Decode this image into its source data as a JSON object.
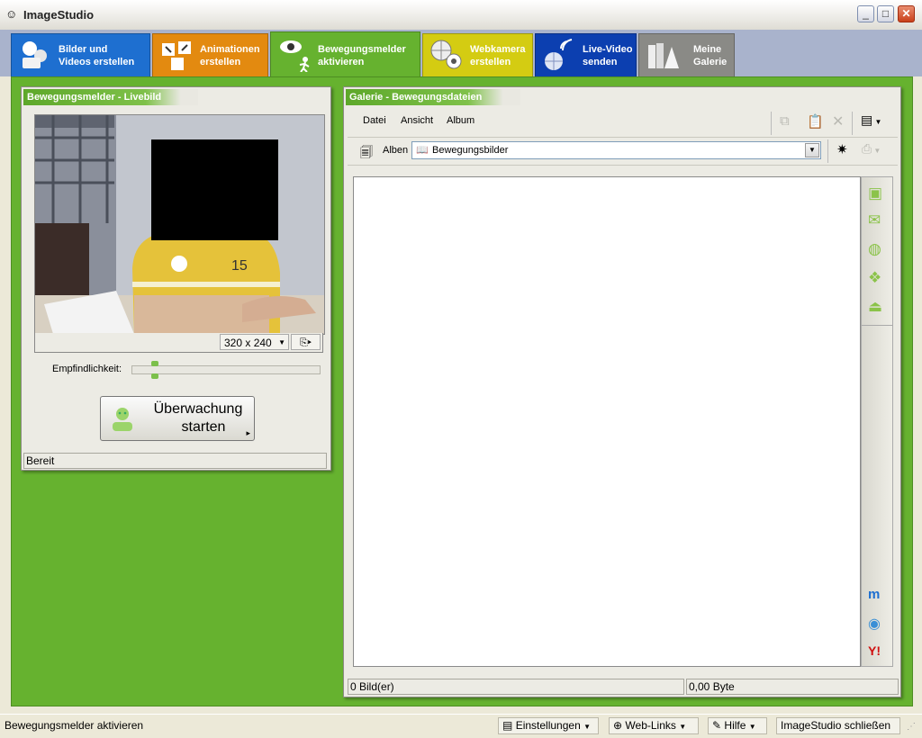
{
  "app": {
    "title": "ImageStudio"
  },
  "tabs": [
    {
      "line1": "Bilder und",
      "line2": "Videos erstellen",
      "color": "#1e6fd0"
    },
    {
      "line1": "Animationen",
      "line2": "erstellen",
      "color": "#e38a10"
    },
    {
      "line1": "Bewegungsmelder",
      "line2": "aktivieren",
      "color": "#66b22f",
      "active": true
    },
    {
      "line1": "Webkamera",
      "line2": "erstellen",
      "color": "#d4cc12"
    },
    {
      "line1": "Live-Video",
      "line2": "senden",
      "color": "#0c3fb0"
    },
    {
      "line1": "Meine",
      "line2": "Galerie",
      "color": "#8a8a86"
    }
  ],
  "left_panel": {
    "title": "Bewegungsmelder - Livebild",
    "resolution": "320 x 240",
    "sensitivity_label": "Empfindlichkeit:",
    "sensitivity_level": 0.12,
    "start_button_line1": "Überwachung",
    "start_button_line2": "starten",
    "status": "Bereit"
  },
  "gallery": {
    "title": "Galerie - Bewegungsdateien",
    "menu": [
      "Datei",
      "Ansicht",
      "Album"
    ],
    "albums_label": "Alben",
    "album_selected": "Bewegungsbilder",
    "status_count": "0 Bild(er)",
    "status_size": "0,00 Byte"
  },
  "bottom": {
    "status": "Bewegungsmelder aktivieren",
    "settings": "Einstellungen",
    "weblinks": "Web-Links",
    "help": "Hilfe",
    "close": "ImageStudio schließen"
  },
  "colors": {
    "accent_green": "#66b22f",
    "window_bg": "#ece9d8"
  }
}
